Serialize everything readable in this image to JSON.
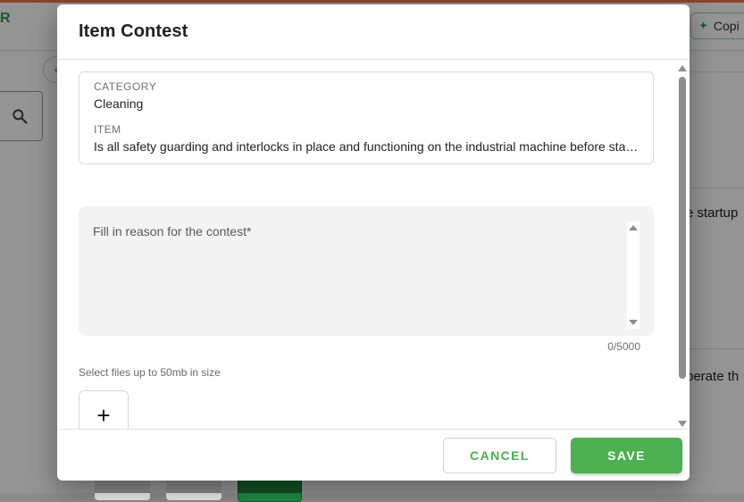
{
  "background": {
    "logo_text": "R",
    "copilot_label": "Copi",
    "text_a": "e startup",
    "text_b": "perate th"
  },
  "dialog": {
    "title": "Item Contest",
    "category_label": "CATEGORY",
    "category_value": "Cleaning",
    "item_label": "ITEM",
    "item_value": "Is all safety guarding and interlocks in place and functioning on the industrial machine before startup?",
    "reason_placeholder": "Fill in reason for the contest*",
    "char_count": "0/5000",
    "files_label": "Select files up to 50mb in size",
    "add_file_symbol": "+",
    "cancel_label": "CANCEL",
    "save_label": "SAVE"
  },
  "colors": {
    "accent_green": "#4caf50",
    "brand_orange": "#e8794a"
  },
  "icons": {
    "search": "search-icon",
    "collapse": "chevron-left-icon",
    "copilot": "sparkle-icon",
    "add": "plus-icon"
  }
}
